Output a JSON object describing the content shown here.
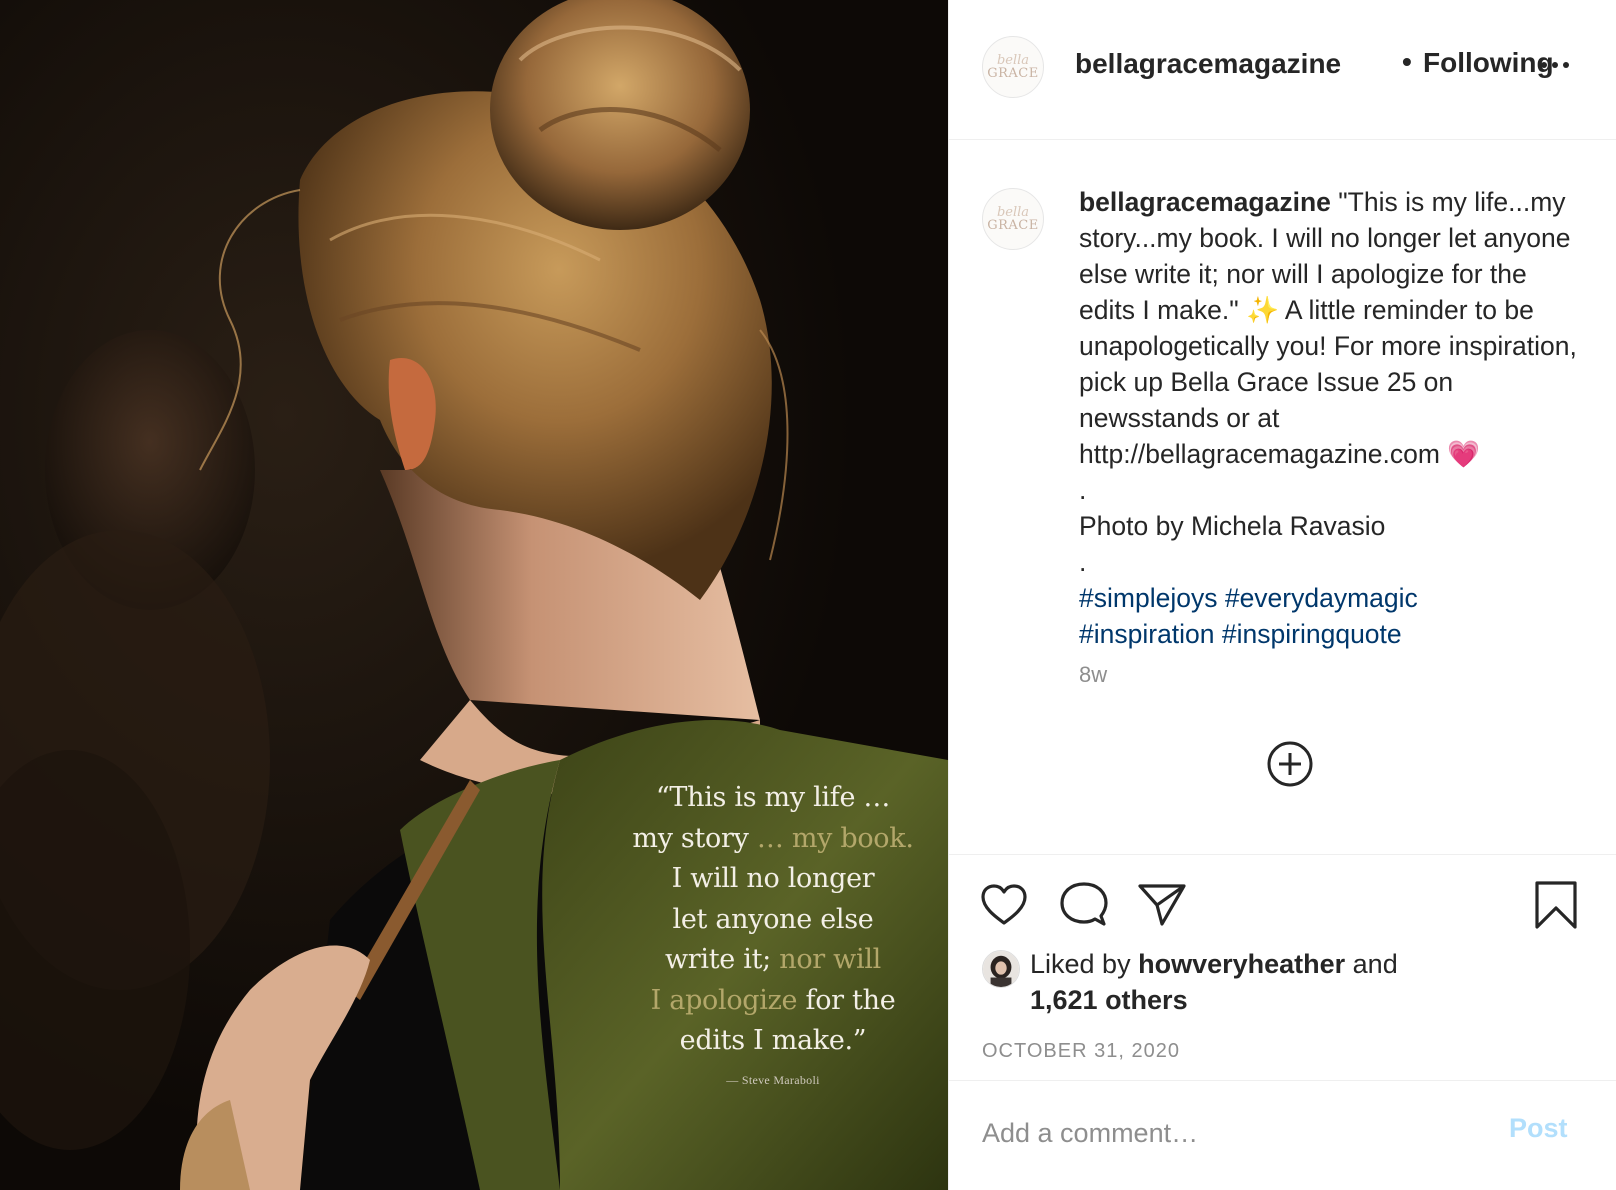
{
  "header": {
    "username": "bellagracemagazine",
    "separator": "•",
    "follow_status": "Following",
    "avatar_logo_top": "bella",
    "avatar_logo_bottom": "GRACE"
  },
  "photo": {
    "quote_lines": [
      {
        "parts": [
          {
            "text": "“This is my life …",
            "accent": false
          }
        ]
      },
      {
        "parts": [
          {
            "text": "my story ",
            "accent": false
          },
          {
            "text": "… my book.",
            "accent": true
          }
        ]
      },
      {
        "parts": [
          {
            "text": "I will no longer",
            "accent": false
          }
        ]
      },
      {
        "parts": [
          {
            "text": "let anyone else",
            "accent": false
          }
        ]
      },
      {
        "parts": [
          {
            "text": "write it; ",
            "accent": false
          },
          {
            "text": "nor will",
            "accent": true
          }
        ]
      },
      {
        "parts": [
          {
            "text": "I apologize",
            "accent": true
          },
          {
            "text": " for the",
            "accent": false
          }
        ]
      },
      {
        "parts": [
          {
            "text": "edits I make.”",
            "accent": false
          }
        ]
      }
    ],
    "quote_author": "— Steve Maraboli"
  },
  "caption": {
    "username": "bellagracemagazine",
    "text_1": " \"This is my life...my story...my book. I will no longer let anyone else write it; nor will I apologize for the edits I make.\" ",
    "sparkles": "✨",
    "text_2": " A little reminder to be unapologetically you! For more inspiration, pick up Bella Grace Issue 25 on newsstands or at http://bellagracemagazine.com ",
    "heart": "💗",
    "dot_1": ".",
    "photo_credit": "Photo by Michela Ravasio",
    "dot_2": ".",
    "hashtags": [
      "#simplejoys",
      "#everydaymagic",
      "#inspiration",
      "#inspiringquote"
    ],
    "time_ago": "8w"
  },
  "actions": {
    "like_icon": "heart-outline",
    "comment_icon": "speech-bubble",
    "share_icon": "paper-plane",
    "save_icon": "bookmark-outline"
  },
  "likes": {
    "prefix": "Liked by ",
    "user": "howveryheather",
    "middle": " and",
    "others": "1,621 others"
  },
  "date": "OCTOBER 31, 2020",
  "comment_form": {
    "placeholder": "Add a comment…",
    "post_label": "Post",
    "post_color": "#b2dffc"
  },
  "colors": {
    "text": "#262626",
    "muted": "#8e8e8e",
    "hashtag": "#00376b",
    "quote_accent": "#b3a76a"
  }
}
